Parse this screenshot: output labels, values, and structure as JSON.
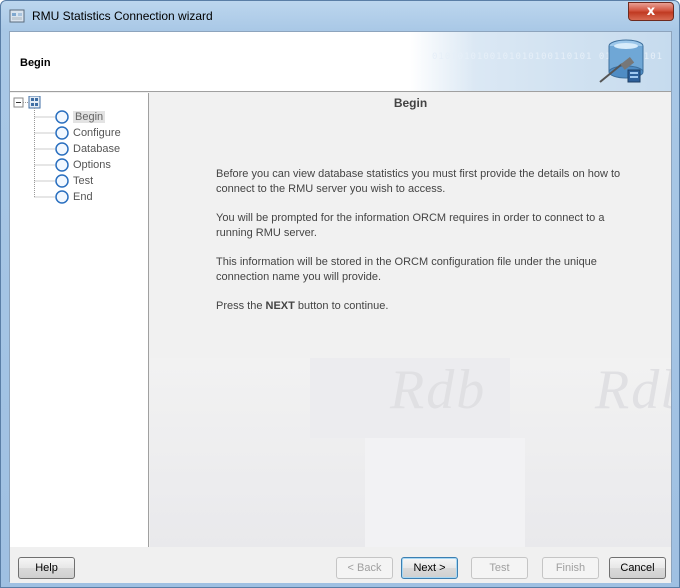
{
  "window": {
    "title": "RMU Statistics Connection wizard",
    "close_label": "x"
  },
  "header": {
    "title": "Begin",
    "decoration_text": "0101010100101010100110101 0101010101"
  },
  "tree": {
    "items": [
      {
        "label": "Begin",
        "selected": true
      },
      {
        "label": "Configure",
        "selected": false
      },
      {
        "label": "Database",
        "selected": false
      },
      {
        "label": "Options",
        "selected": false
      },
      {
        "label": "Test",
        "selected": false
      },
      {
        "label": "End",
        "selected": false
      }
    ]
  },
  "content": {
    "title": "Begin",
    "para1": "Before you can view database statistics you must first provide the details on how to connect to the RMU server you wish to access.",
    "para2": "You will be prompted for the information ORCM requires in order to connect to a running RMU server.",
    "para3": "This information will be stored in the ORCM configuration file under the unique connection name you will provide.",
    "para4_prefix": "Press the ",
    "para4_bold": "NEXT",
    "para4_suffix": " button to continue.",
    "watermark": "Rdb"
  },
  "footer": {
    "help": "Help",
    "back": "< Back",
    "next": "Next >",
    "test": "Test",
    "finish": "Finish",
    "cancel": "Cancel"
  },
  "colors": {
    "accent": "#3c7fb1",
    "tree_node": "#2a6fbf"
  }
}
